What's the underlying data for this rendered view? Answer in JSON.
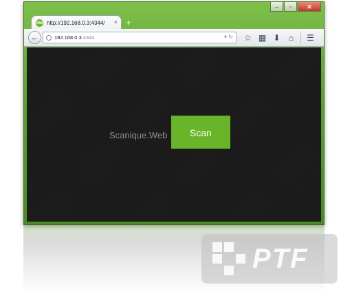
{
  "browser": {
    "tab": {
      "title": "http://192.168.0.3:4344/",
      "favicon": "sw",
      "close_glyph": "×"
    },
    "new_tab_glyph": "+",
    "url": {
      "host": "192.168.0.3",
      "port": ":4344"
    },
    "window_buttons": {
      "minimize": "‒",
      "maximize": "▫",
      "close": "✕"
    },
    "toolbar_icons": [
      "star-icon",
      "clipboard-icon",
      "download-icon",
      "home-icon",
      "menu-icon"
    ]
  },
  "page": {
    "brand": "Scanique.Web",
    "scan_button": "Scan"
  },
  "watermark": {
    "text": "PTF"
  },
  "colors": {
    "accent": "#6ab42a",
    "frame": "#5fa232",
    "content_bg": "#1b1b1b"
  }
}
